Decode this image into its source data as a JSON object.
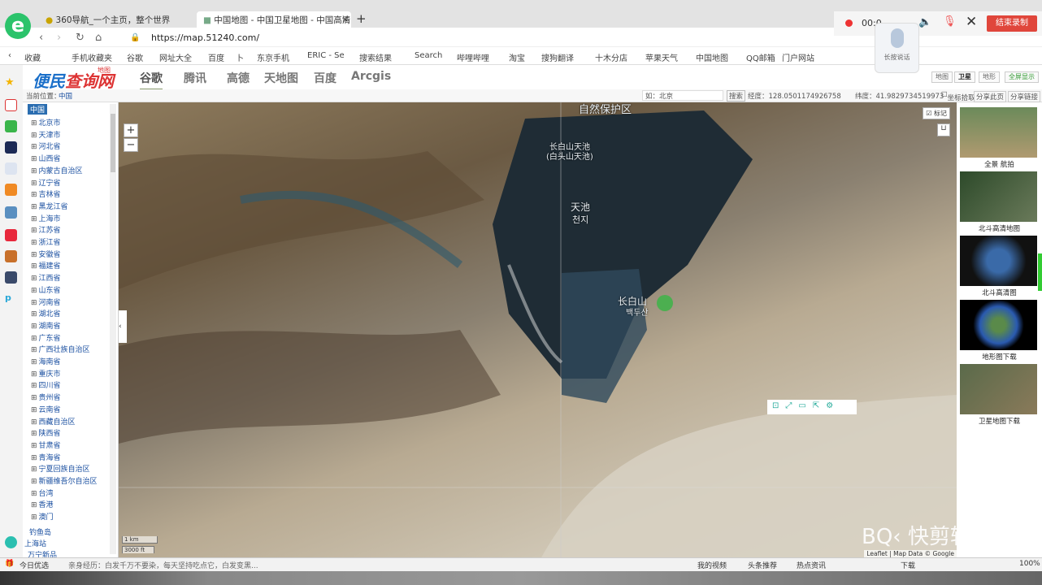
{
  "browser": {
    "tabs": [
      {
        "label": "360导航_一个主页，整个世界"
      },
      {
        "label": "中国地图 - 中国卫星地图 - 中国高清"
      }
    ],
    "new_tab": "+",
    "close_tab": "×",
    "url": "https://map.51240.com/",
    "bookmarks": [
      "收藏",
      "手机收藏夹",
      "谷歌",
      "网址大全",
      "百度",
      "卜",
      "东京手机",
      "ERIC - Se",
      "搜索结果",
      "Search",
      "哔哩哔哩",
      "淘宝",
      "搜狗翻译",
      "十木分店",
      "苹果天气",
      "中国地图",
      "QQ邮箱",
      "门户网站"
    ],
    "recorder": {
      "time": "00:0",
      "end_label": "结束录制",
      "voice_label": "长按说话"
    }
  },
  "site": {
    "brand": "便民",
    "brand2": "查询网",
    "brand_small": "地图",
    "map_tabs": [
      "谷歌",
      "腾讯",
      "高德",
      "天地图",
      "百度",
      "Arcgis"
    ],
    "active_tab": "谷歌",
    "view_buttons": [
      "地图",
      "卫星",
      "地形",
      "全屏显示"
    ],
    "info": {
      "location_label": "当前位置：",
      "location": "中国",
      "search_placeholder": "如：北京",
      "search_btn": "搜索",
      "lng": "经度：128.0501174926758",
      "lat": "纬度：41.9829734519973",
      "coord_pick": "坐标拾取",
      "share": "分享此页",
      "share2": "分享链接"
    }
  },
  "tree": {
    "root": "中国",
    "items": [
      "北京市",
      "天津市",
      "河北省",
      "山西省",
      "内蒙古自治区",
      "辽宁省",
      "吉林省",
      "黑龙江省",
      "上海市",
      "江苏省",
      "浙江省",
      "安徽省",
      "福建省",
      "江西省",
      "山东省",
      "河南省",
      "湖北省",
      "湖南省",
      "广东省",
      "广西壮族自治区",
      "海南省",
      "重庆市",
      "四川省",
      "贵州省",
      "云南省",
      "西藏自治区",
      "陕西省",
      "甘肃省",
      "青海省",
      "宁夏回族自治区",
      "新疆维吾尔自治区",
      "台湾",
      "香港",
      "澳门"
    ],
    "extra": [
      "钓鱼岛",
      "上海站",
      "万宁新品"
    ]
  },
  "map": {
    "zoom_in": "+",
    "zoom_out": "−",
    "layer_label": "标记",
    "labels": {
      "reserve": "自然保护区",
      "lake1": "长白山天池",
      "lake2": "(白头山天池)",
      "tianchi": "天池",
      "tianchi_kr": "천지",
      "mountain": "长白山",
      "mountain_kr": "백두산"
    },
    "scale": {
      "km": "1 km",
      "ft": "3000 ft"
    },
    "attribution": "Leaflet | Map Data © Google"
  },
  "right_panel": {
    "items": [
      "全景 航拍",
      "北斗高清地图",
      "北斗高清图",
      "地形图下载",
      "卫星地图下载"
    ]
  },
  "status": {
    "left1": "今日优选",
    "left2": "亲身经历：白发千万不要染，每天坚持吃点它，白发变黑...",
    "right": [
      "我的视频",
      "头条推荐",
      "热点资讯",
      "下载",
      "100%"
    ]
  },
  "watermark": "快剪辑"
}
